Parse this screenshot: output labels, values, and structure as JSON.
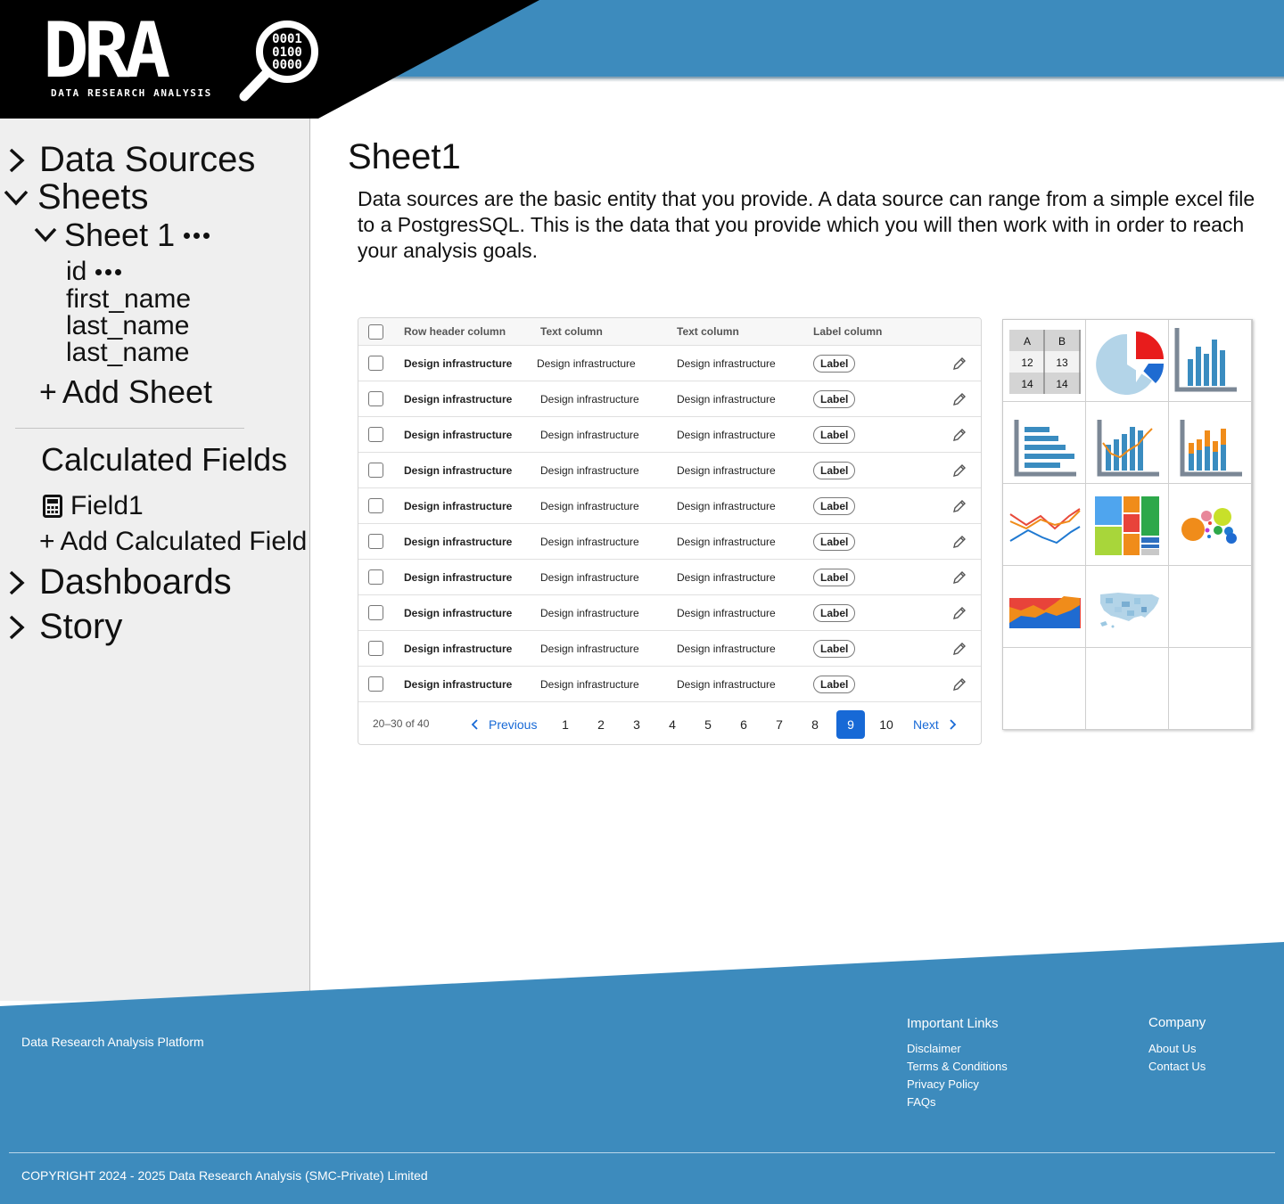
{
  "header": {
    "logo_word": "DRA",
    "logo_sub": "DATA RESEARCH ANALYSIS",
    "logo_bits": [
      "0001",
      "0100",
      "0000"
    ]
  },
  "sidebar": {
    "data_sources": "Data Sources",
    "sheets": "Sheets",
    "sheet_name": "Sheet 1",
    "fields": [
      "id",
      "first_name",
      "last_name",
      "last_name"
    ],
    "add_sheet": "Add Sheet",
    "calculated_fields": "Calculated Fields",
    "calc_field": "Field1",
    "add_calculated_field": "Add Calculated Field",
    "dashboards": "Dashboards",
    "story": "Story"
  },
  "main": {
    "title": "Sheet1",
    "description": "Data sources are the basic entity that you provide. A data source can range from a simple excel file to a PostgresSQL. This is the data that you provide which you will then work with in order to reach your analysis goals."
  },
  "table": {
    "columns": [
      "Row header column",
      "Text column",
      "Text column",
      "Label column"
    ],
    "rows": [
      [
        "Design infrastructure",
        "Design infrastructure",
        "Design infrastructure",
        "Label"
      ],
      [
        "Design infrastructure",
        "Design infrastructure",
        "Design infrastructure",
        "Label"
      ],
      [
        "Design infrastructure",
        "Design infrastructure",
        "Design infrastructure",
        "Label"
      ],
      [
        "Design infrastructure",
        "Design infrastructure",
        "Design infrastructure",
        "Label"
      ],
      [
        "Design infrastructure",
        "Design infrastructure",
        "Design infrastructure",
        "Label"
      ],
      [
        "Design infrastructure",
        "Design infrastructure",
        "Design infrastructure",
        "Label"
      ],
      [
        "Design infrastructure",
        "Design infrastructure",
        "Design infrastructure",
        "Label"
      ],
      [
        "Design infrastructure",
        "Design infrastructure",
        "Design infrastructure",
        "Label"
      ],
      [
        "Design infrastructure",
        "Design infrastructure",
        "Design infrastructure",
        "Label"
      ],
      [
        "Design infrastructure",
        "Design infrastructure",
        "Design infrastructure",
        "Label"
      ]
    ],
    "pagination": {
      "count": "20–30 of 40",
      "previous": "Previous",
      "next": "Next",
      "pages": [
        "1",
        "2",
        "3",
        "4",
        "5",
        "6",
        "7",
        "8",
        "9",
        "10"
      ],
      "current": "9"
    }
  },
  "chart_types": {
    "table_icon": {
      "headers": [
        "A",
        "B"
      ],
      "rows": [
        [
          "12",
          "13"
        ],
        [
          "14",
          "14"
        ]
      ]
    },
    "items": [
      "table-chart",
      "pie-chart",
      "vertical-bar-chart",
      "horizontal-bar-chart",
      "bar-line-combo-chart",
      "stacked-bar-chart",
      "multi-line-chart",
      "treemap-chart",
      "bubble-chart",
      "area-chart",
      "us-map-chart"
    ]
  },
  "footer": {
    "platform": "Data Research Analysis Platform",
    "important_links_title": "Important Links",
    "important_links": [
      "Disclaimer",
      "Terms & Conditions",
      "Privacy Policy",
      "FAQs"
    ],
    "company_title": "Company",
    "company_links": [
      "About Us",
      "Contact Us"
    ],
    "copyright": "COPYRIGHT 2024 - 2025 Data Research Analysis (SMC-Private) Limited"
  },
  "colors": {
    "brand_blue": "#3d8bbd",
    "header_black": "#000000",
    "sidebar_bg": "#efefef",
    "active_page": "#1769d6"
  }
}
